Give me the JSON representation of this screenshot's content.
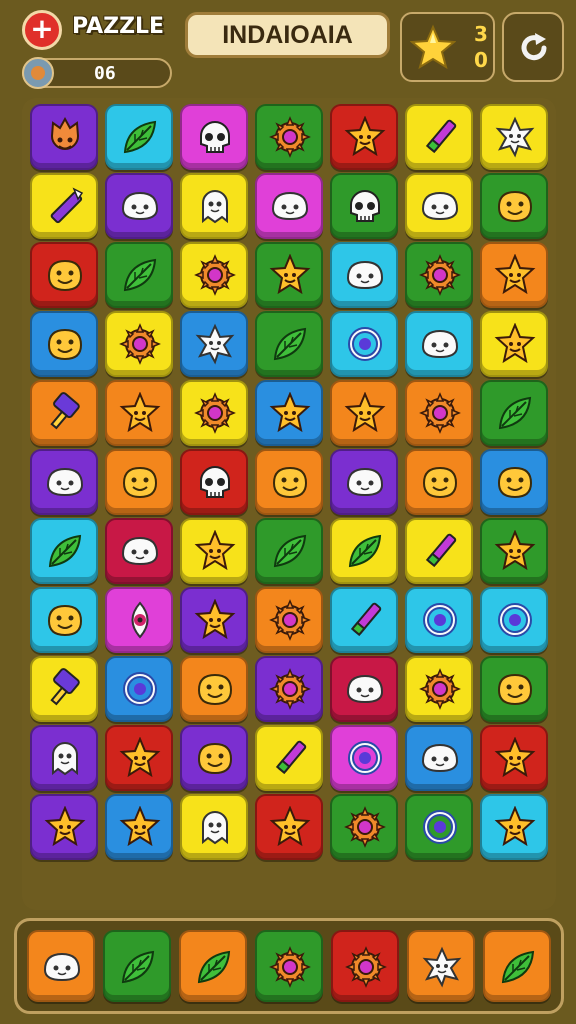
{
  "hud": {
    "app_label": "PAZZLE",
    "logo_glyph": "+",
    "counter_value": "06",
    "title": "INDAIOAIA",
    "stars_top": "3",
    "stars_bottom": "0",
    "refresh_icon": "refresh-icon"
  },
  "colors": {
    "purple": "#7b2fd0",
    "cyan": "#2ec6e8",
    "magenta": "#e040d8",
    "green": "#2f9a2a",
    "red": "#d0241c",
    "yellow": "#f7e21a",
    "orange": "#f3861c",
    "blue": "#2a8fe0",
    "crimson": "#c81846"
  },
  "board": {
    "rows": [
      [
        {
          "c": "purple",
          "i": "flame-face"
        },
        {
          "c": "cyan",
          "i": "leaf"
        },
        {
          "c": "magenta",
          "i": "skull"
        },
        {
          "c": "green",
          "i": "gear"
        },
        {
          "c": "red",
          "i": "star-face"
        },
        {
          "c": "yellow",
          "i": "pencil"
        },
        {
          "c": "yellow",
          "i": "ghost-star"
        }
      ],
      [
        {
          "c": "yellow",
          "i": "wand"
        },
        {
          "c": "purple",
          "i": "blob-face"
        },
        {
          "c": "yellow",
          "i": "ghost-face"
        },
        {
          "c": "magenta",
          "i": "blob-face"
        },
        {
          "c": "green",
          "i": "skull"
        },
        {
          "c": "yellow",
          "i": "blob-face"
        },
        {
          "c": "green",
          "i": "smile-face"
        }
      ],
      [
        {
          "c": "red",
          "i": "smile-face"
        },
        {
          "c": "green",
          "i": "leaf"
        },
        {
          "c": "yellow",
          "i": "gear"
        },
        {
          "c": "green",
          "i": "star-face"
        },
        {
          "c": "cyan",
          "i": "blob-face"
        },
        {
          "c": "green",
          "i": "gear"
        },
        {
          "c": "orange",
          "i": "star-face"
        }
      ],
      [
        {
          "c": "blue",
          "i": "smile-face"
        },
        {
          "c": "yellow",
          "i": "gear"
        },
        {
          "c": "blue",
          "i": "ghost-star"
        },
        {
          "c": "green",
          "i": "leaf"
        },
        {
          "c": "cyan",
          "i": "ring"
        },
        {
          "c": "cyan",
          "i": "blob-face"
        },
        {
          "c": "yellow",
          "i": "star-face"
        }
      ],
      [
        {
          "c": "orange",
          "i": "brush"
        },
        {
          "c": "orange",
          "i": "star-face"
        },
        {
          "c": "yellow",
          "i": "gear"
        },
        {
          "c": "blue",
          "i": "star-face"
        },
        {
          "c": "orange",
          "i": "star-face"
        },
        {
          "c": "orange",
          "i": "gear"
        },
        {
          "c": "green",
          "i": "leaf"
        }
      ],
      [
        {
          "c": "purple",
          "i": "blob-face"
        },
        {
          "c": "orange",
          "i": "smile-face"
        },
        {
          "c": "red",
          "i": "skull"
        },
        {
          "c": "orange",
          "i": "smile-face"
        },
        {
          "c": "purple",
          "i": "blob-face"
        },
        {
          "c": "orange",
          "i": "smile-face"
        },
        {
          "c": "blue",
          "i": "smile-face"
        }
      ],
      [
        {
          "c": "cyan",
          "i": "leaf"
        },
        {
          "c": "crimson",
          "i": "blob-face"
        },
        {
          "c": "yellow",
          "i": "star-face"
        },
        {
          "c": "green",
          "i": "leaf"
        },
        {
          "c": "yellow",
          "i": "leaf"
        },
        {
          "c": "yellow",
          "i": "pencil"
        },
        {
          "c": "green",
          "i": "star-face"
        }
      ],
      [
        {
          "c": "cyan",
          "i": "smile-face"
        },
        {
          "c": "magenta",
          "i": "eye"
        },
        {
          "c": "purple",
          "i": "star-face"
        },
        {
          "c": "orange",
          "i": "gear"
        },
        {
          "c": "cyan",
          "i": "pencil"
        },
        {
          "c": "cyan",
          "i": "ring"
        },
        {
          "c": "cyan",
          "i": "ring"
        }
      ],
      [
        {
          "c": "yellow",
          "i": "brush"
        },
        {
          "c": "blue",
          "i": "ring"
        },
        {
          "c": "orange",
          "i": "smile-face"
        },
        {
          "c": "purple",
          "i": "gear"
        },
        {
          "c": "crimson",
          "i": "blob-face"
        },
        {
          "c": "yellow",
          "i": "gear"
        },
        {
          "c": "green",
          "i": "smile-face"
        }
      ],
      [
        {
          "c": "purple",
          "i": "ghost-face"
        },
        {
          "c": "red",
          "i": "star-face"
        },
        {
          "c": "purple",
          "i": "smile-face"
        },
        {
          "c": "yellow",
          "i": "pencil"
        },
        {
          "c": "magenta",
          "i": "ring"
        },
        {
          "c": "blue",
          "i": "blob-face"
        },
        {
          "c": "red",
          "i": "star-face"
        }
      ],
      [
        {
          "c": "purple",
          "i": "star-face"
        },
        {
          "c": "blue",
          "i": "star-face"
        },
        {
          "c": "yellow",
          "i": "ghost-face"
        },
        {
          "c": "red",
          "i": "star-face"
        },
        {
          "c": "green",
          "i": "gear"
        },
        {
          "c": "green",
          "i": "ring"
        },
        {
          "c": "cyan",
          "i": "star-face"
        }
      ]
    ]
  },
  "tray": {
    "items": [
      {
        "c": "orange",
        "i": "blob-face"
      },
      {
        "c": "green",
        "i": "leaf"
      },
      {
        "c": "orange",
        "i": "leaf"
      },
      {
        "c": "green",
        "i": "gear"
      },
      {
        "c": "red",
        "i": "gear"
      },
      {
        "c": "orange",
        "i": "ghost-star"
      },
      {
        "c": "orange",
        "i": "leaf"
      }
    ]
  }
}
